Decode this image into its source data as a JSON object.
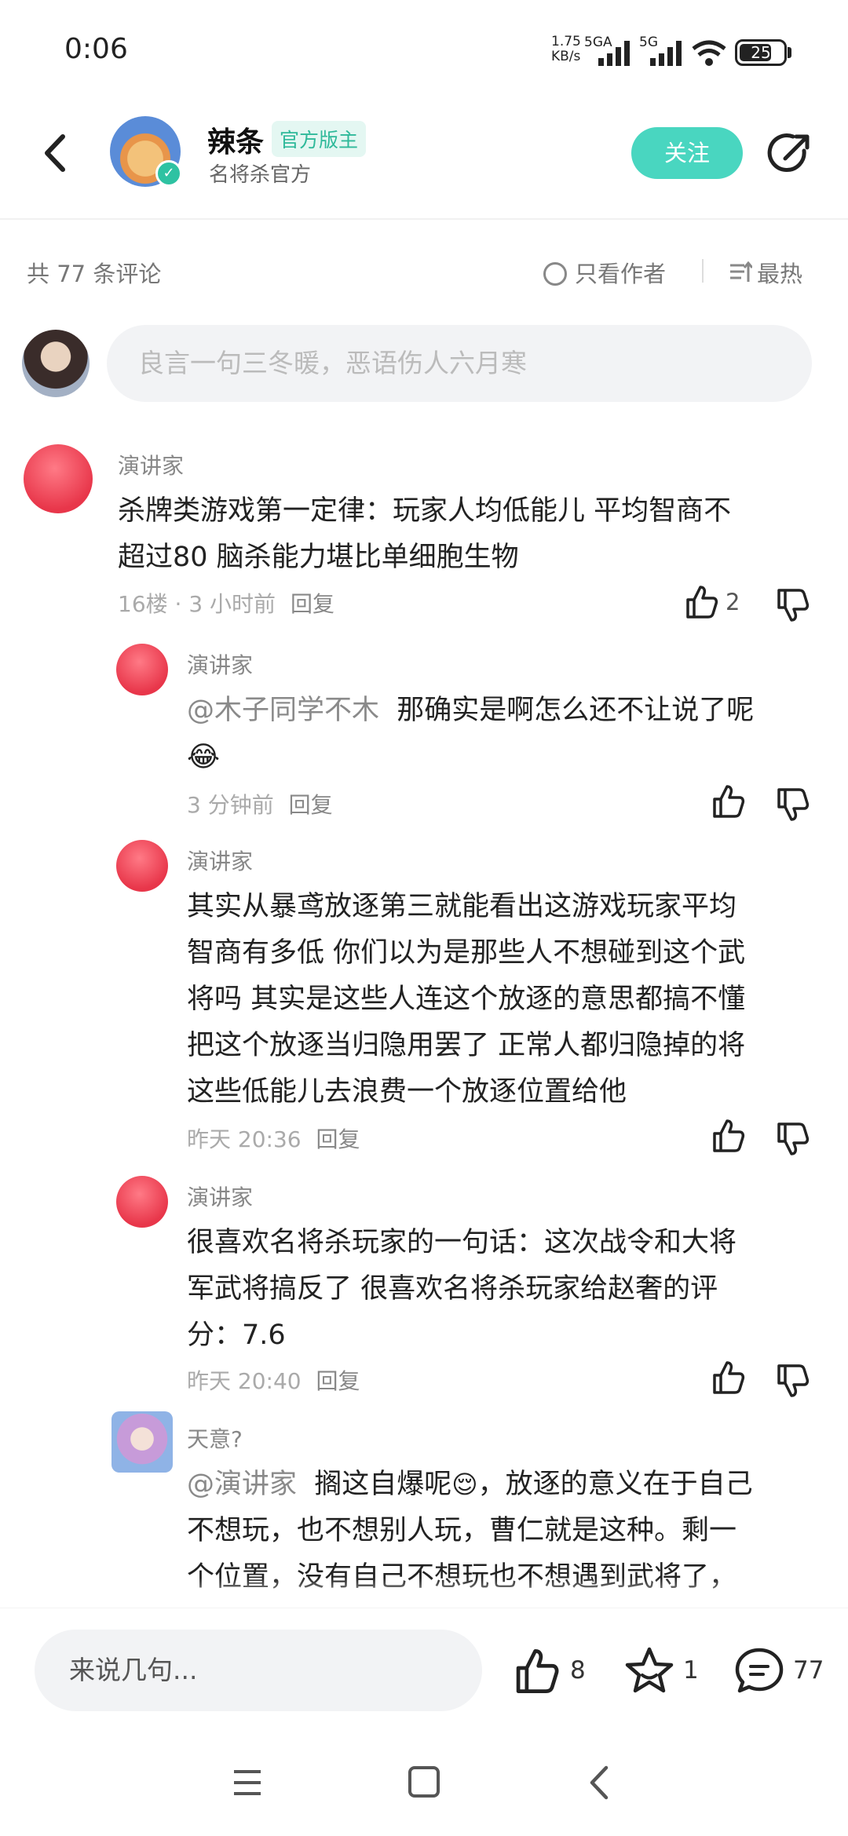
{
  "status_bar": {
    "time": "0:06",
    "net_speed_value": "1.75",
    "net_speed_unit": "KB/s",
    "sim1": "5GA",
    "sim2": "5G",
    "battery": "25"
  },
  "header": {
    "author_name": "辣条",
    "author_badge": "官方版主",
    "author_subtitle": "名将杀官方",
    "follow_label": "关注"
  },
  "comments_meta": {
    "count_label": "共 77 条评论",
    "only_author_label": "只看作者",
    "sort_label": "最热"
  },
  "comment_input": {
    "placeholder": "良言一句三冬暖，恶语伤人六月寒"
  },
  "comments": [
    {
      "name": "演讲家",
      "line1": "杀牌类游戏第一定律：玩家人均低能儿 平均智商不",
      "line2": "超过80 脑杀能力堪比单细胞生物",
      "floor_time": "16楼 · 3 小时前",
      "reply": "回复",
      "likes": "2"
    }
  ],
  "replies": [
    {
      "name": "演讲家",
      "mention": "@木子同学不木",
      "line1_rest": "那确实是啊怎么还不让说了呢",
      "emoji": "😂",
      "time": "3 分钟前",
      "reply": "回复"
    },
    {
      "name": "演讲家",
      "lines": [
        "其实从暴鸢放逐第三就能看出这游戏玩家平均",
        "智商有多低 你们以为是那些人不想碰到这个武",
        "将吗 其实是这些人连这个放逐的意思都搞不懂",
        "把这个放逐当归隐用罢了 正常人都归隐掉的将",
        "这些低能儿去浪费一个放逐位置给他"
      ],
      "time": "昨天 20:36",
      "reply": "回复"
    },
    {
      "name": "演讲家",
      "lines": [
        "很喜欢名将杀玩家的一句话：这次战令和大将",
        "军武将搞反了 很喜欢名将杀玩家给赵奢的评",
        "分：7.6"
      ],
      "time": "昨天 20:40",
      "reply": "回复"
    },
    {
      "name": "天意?",
      "mention": "@演讲家",
      "line1_rest": "搁这自爆呢",
      "emoji": "😌",
      "line1_tail": "，放逐的意义在于自己",
      "lines": [
        "不想玩，也不想别人玩，曹仁就是这种。剩一",
        "个位置，没有自己不想玩也不想遇到武将了，"
      ]
    }
  ],
  "bottom_bar": {
    "input_placeholder": "来说几句...",
    "likes": "8",
    "stars": "1",
    "comments": "77"
  },
  "colors": {
    "accent": "#49d6c0",
    "badge_text": "#2fb99a",
    "avatar_red": "#e8364a"
  }
}
